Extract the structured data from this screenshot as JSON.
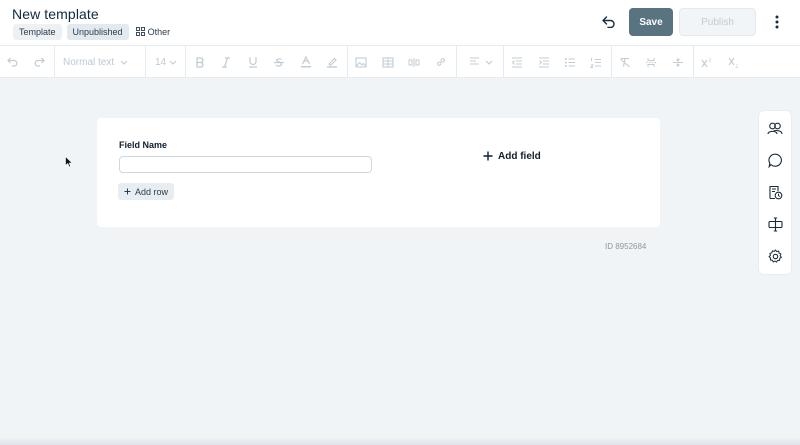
{
  "header": {
    "title": "New template",
    "tags": [
      "Template",
      "Unpublished"
    ],
    "other_label": "Other",
    "save_label": "Save",
    "publish_label": "Publish"
  },
  "toolbar": {
    "text_style": "Normal text",
    "font_size": "14",
    "icons": [
      "undo-icon",
      "redo-icon",
      "bold-icon",
      "italic-icon",
      "underline-icon",
      "strikethrough-icon",
      "text-color-icon",
      "highlight-icon",
      "image-icon",
      "table-icon",
      "embed-icon",
      "link-icon",
      "align-icon",
      "outdent-icon",
      "indent-icon",
      "bullet-list-icon",
      "numbered-list-icon",
      "clear-format-icon",
      "page-break-icon",
      "divider-icon",
      "superscript-icon",
      "subscript-icon"
    ]
  },
  "card": {
    "field_label": "Field Name",
    "field_value": "",
    "add_row_label": "Add row",
    "add_field_label": "Add field"
  },
  "doc_id": "ID 8952684",
  "side_panel": {
    "icons": [
      "people-icon",
      "comment-icon",
      "document-history-icon",
      "variables-icon",
      "settings-icon"
    ]
  },
  "colors": {
    "save_button": "#5a7380",
    "background": "#f0f4f7",
    "text_dark": "#0f2a3f"
  }
}
